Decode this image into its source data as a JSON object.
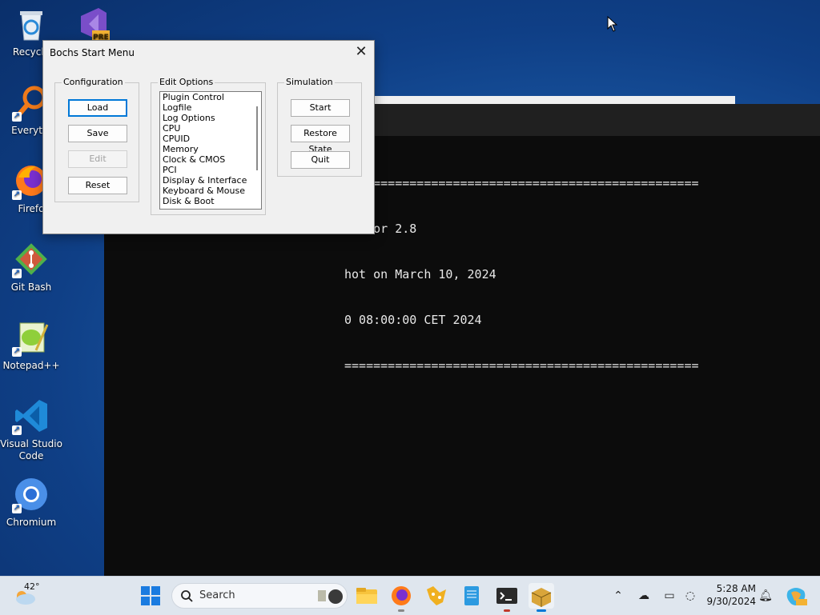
{
  "desktop": {
    "icons": [
      {
        "label": "Recycle",
        "icon": "recycle-bin-icon"
      },
      {
        "label": "",
        "icon": "visual-studio-preview-icon"
      },
      {
        "label": "Everythi",
        "icon": "everything-search-icon"
      },
      {
        "label": "Firefo",
        "icon": "firefox-icon"
      },
      {
        "label": "Git Bash",
        "icon": "git-bash-icon"
      },
      {
        "label": "Notepad++",
        "icon": "notepad-plus-plus-icon"
      },
      {
        "label": "Visual Studio Code",
        "icon": "vscode-icon"
      },
      {
        "label": "Chromium",
        "icon": "chromium-icon"
      }
    ],
    "badge_pre": "PRE"
  },
  "terminal": {
    "lines": [
      "=================================================",
      "ulator 2.8",
      "hot on March 10, 2024",
      "0 08:00:00 CET 2024",
      "================================================="
    ]
  },
  "dialog": {
    "title": "Bochs Start Menu",
    "close_glyph": "✕",
    "configuration": {
      "title": "Configuration",
      "load": "Load",
      "save": "Save",
      "edit": "Edit",
      "reset": "Reset"
    },
    "edit_options": {
      "title": "Edit Options",
      "items": [
        "Plugin Control",
        "Logfile",
        "Log Options",
        "CPU",
        "CPUID",
        "Memory",
        "Clock & CMOS",
        "PCI",
        "Display & Interface",
        "Keyboard & Mouse",
        "Disk & Boot"
      ]
    },
    "simulation": {
      "title": "Simulation",
      "start": "Start",
      "restore_state": "Restore State",
      "quit": "Quit"
    }
  },
  "taskbar": {
    "weather_temp": "42°",
    "search_placeholder": "Search",
    "time": "5:28 AM",
    "date": "9/30/2024",
    "pinned": [
      "start-icon",
      "file-explorer-icon",
      "firefox-icon",
      "git-icon",
      "notepad-icon",
      "terminal-icon",
      "bochs-icon"
    ]
  },
  "colors": {
    "accent": "#0078d7",
    "desktop": "#1b5aa6",
    "terminal_bg": "#0c0c0c"
  }
}
